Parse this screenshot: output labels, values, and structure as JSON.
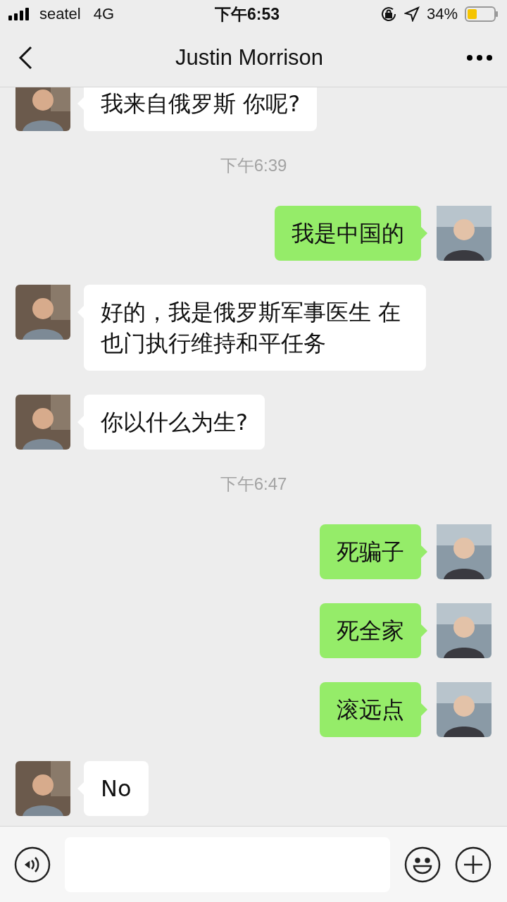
{
  "status_bar": {
    "carrier": "seatel",
    "network": "4G",
    "time": "下午6:53",
    "battery": "34%"
  },
  "nav": {
    "title": "Justin  Morrison"
  },
  "chat": [
    {
      "kind": "received",
      "text": "我来自俄罗斯 你呢?"
    },
    {
      "kind": "time",
      "text": "下午6:39"
    },
    {
      "kind": "sent",
      "text": "我是中国的"
    },
    {
      "kind": "received",
      "text": "好的，我是俄罗斯军事医生 在也门执行维持和平任务"
    },
    {
      "kind": "received",
      "text": "你以什么为生?"
    },
    {
      "kind": "time",
      "text": "下午6:47"
    },
    {
      "kind": "sent",
      "text": "死骗子"
    },
    {
      "kind": "sent",
      "text": "死全家"
    },
    {
      "kind": "sent",
      "text": "滚远点"
    },
    {
      "kind": "received",
      "text": "No"
    }
  ]
}
